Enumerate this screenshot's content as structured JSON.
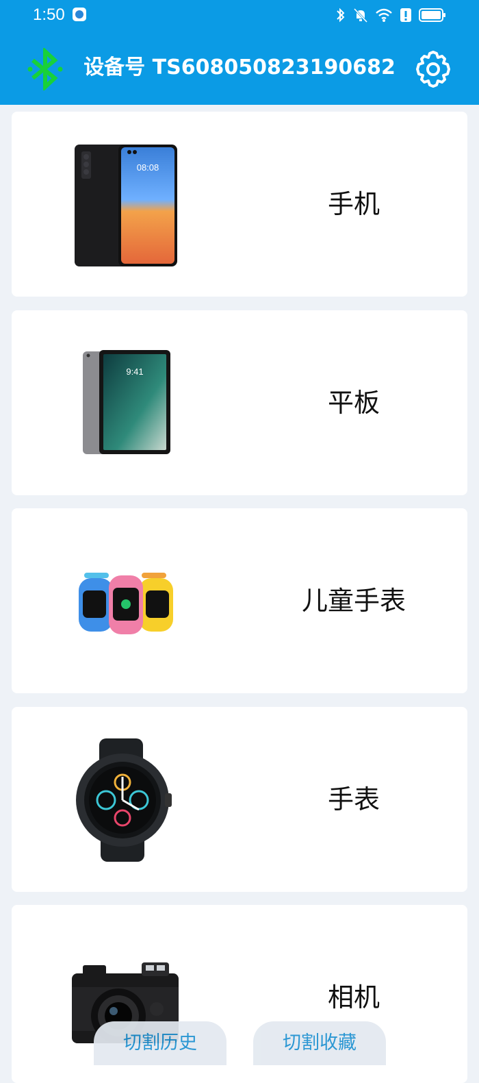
{
  "status_bar": {
    "time": "1:50",
    "icons": [
      "bluetooth-icon",
      "mute-icon",
      "wifi-icon",
      "alert-icon",
      "battery-icon"
    ]
  },
  "header": {
    "title": "设备号 TS608050823190682",
    "bluetooth_icon": "bluetooth-icon",
    "settings_icon": "gear-icon",
    "background": "#0b9be5",
    "bluetooth_color": "#18d13a"
  },
  "devices": [
    {
      "label": "手机",
      "icon": "phone-image"
    },
    {
      "label": "平板",
      "icon": "tablet-image"
    },
    {
      "label": "儿童手表",
      "icon": "kids-watch-image"
    },
    {
      "label": "手表",
      "icon": "smartwatch-image"
    },
    {
      "label": "相机",
      "icon": "camera-image"
    }
  ],
  "bottom_buttons": {
    "history": "切割历史",
    "favorites": "切割收藏"
  }
}
